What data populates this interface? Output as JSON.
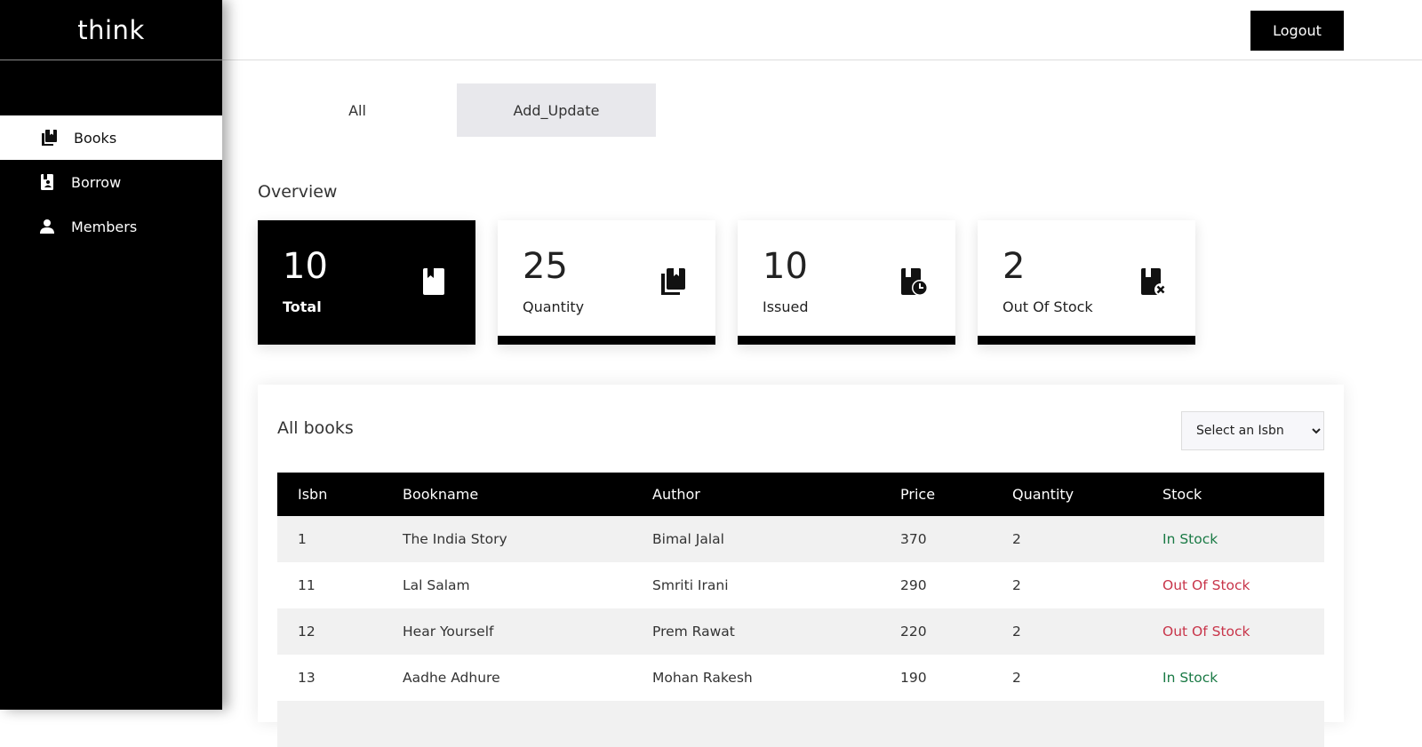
{
  "app": {
    "brand": "think"
  },
  "header": {
    "logout_label": "Logout"
  },
  "sidebar": {
    "items": [
      {
        "label": "Books",
        "icon": "books-icon",
        "active": true
      },
      {
        "label": "Borrow",
        "icon": "borrow-icon",
        "active": false
      },
      {
        "label": "Members",
        "icon": "person-icon",
        "active": false
      }
    ]
  },
  "tabs": [
    {
      "label": "All",
      "active": false
    },
    {
      "label": "Add_Update",
      "active": true
    }
  ],
  "overview": {
    "title": "Overview",
    "cards": [
      {
        "value": "10",
        "label": "Total",
        "icon": "book-icon"
      },
      {
        "value": "25",
        "label": "Quantity",
        "icon": "books-stack-icon"
      },
      {
        "value": "10",
        "label": "Issued",
        "icon": "book-clock-icon"
      },
      {
        "value": "2",
        "label": "Out Of Stock",
        "icon": "book-x-icon"
      }
    ]
  },
  "books": {
    "title": "All books",
    "select_value": "Select an Isbn",
    "columns": [
      "Isbn",
      "Bookname",
      "Author",
      "Price",
      "Quantity",
      "Stock"
    ],
    "rows": [
      {
        "isbn": "1",
        "bookname": "The India Story",
        "author": "Bimal Jalal",
        "price": "370",
        "quantity": "2",
        "stock": "In Stock"
      },
      {
        "isbn": "11",
        "bookname": "Lal Salam",
        "author": "Smriti Irani",
        "price": "290",
        "quantity": "2",
        "stock": "Out Of Stock"
      },
      {
        "isbn": "12",
        "bookname": "Hear Yourself",
        "author": "Prem Rawat",
        "price": "220",
        "quantity": "2",
        "stock": "Out Of Stock"
      },
      {
        "isbn": "13",
        "bookname": "Aadhe Adhure",
        "author": "Mohan Rakesh",
        "price": "190",
        "quantity": "2",
        "stock": "In Stock"
      }
    ]
  },
  "colors": {
    "in_stock": "#1a7a45",
    "out_of_stock": "#c8354a",
    "accent": "#000000"
  }
}
